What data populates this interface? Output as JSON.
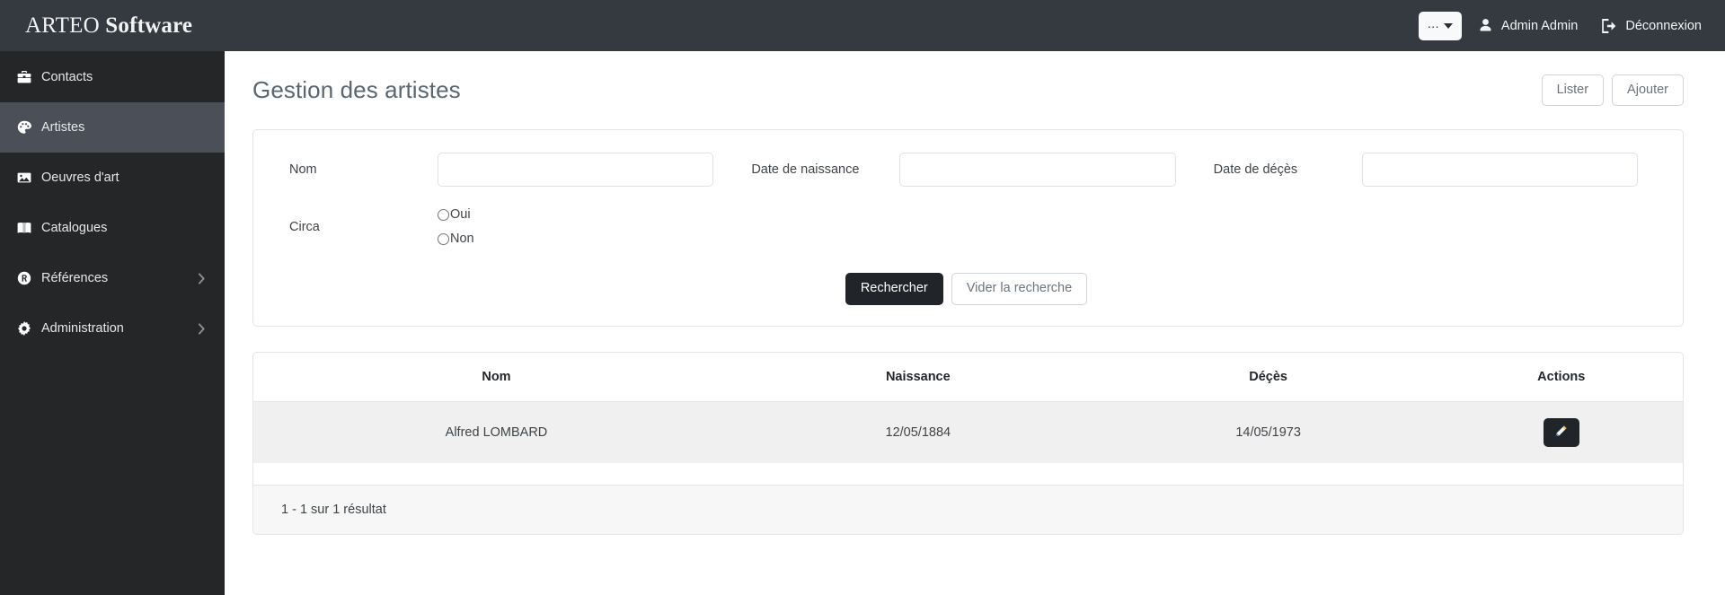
{
  "topbar": {
    "brand_prefix": "ARTEO ",
    "brand_suffix": "Software",
    "lang_button_label": "...",
    "lang_icon": "chevron-down-icon",
    "user_icon": "user-icon",
    "user_name": "Admin Admin",
    "logout_icon": "logout-icon",
    "logout_label": "Déconnexion"
  },
  "sidebar": {
    "items": [
      {
        "label": "Contacts",
        "icon": "briefcase-icon",
        "active": false,
        "expandable": false
      },
      {
        "label": "Artistes",
        "icon": "palette-icon",
        "active": true,
        "expandable": false
      },
      {
        "label": "Oeuvres d'art",
        "icon": "image-icon",
        "active": false,
        "expandable": false
      },
      {
        "label": "Catalogues",
        "icon": "book-icon",
        "active": false,
        "expandable": false
      },
      {
        "label": "Références",
        "icon": "registered-icon",
        "active": false,
        "expandable": true
      },
      {
        "label": "Administration",
        "icon": "gear-icon",
        "active": false,
        "expandable": true
      }
    ]
  },
  "page": {
    "title": "Gestion des artistes",
    "list_button": "Lister",
    "add_button": "Ajouter"
  },
  "search": {
    "nom_label": "Nom",
    "nom_value": "",
    "nom_placeholder": "",
    "naissance_label": "Date de naissance",
    "naissance_value": "",
    "naissance_placeholder": "",
    "deces_label": "Date de déçès",
    "deces_value": "",
    "deces_placeholder": "",
    "circa_label": "Circa",
    "circa_options": [
      "Oui",
      "Non"
    ],
    "circa_selected": null,
    "submit_label": "Rechercher",
    "reset_label": "Vider la recherche"
  },
  "table": {
    "columns": [
      "Nom",
      "Naissance",
      "Déçès",
      "Actions"
    ],
    "rows": [
      {
        "nom": "Alfred LOMBARD",
        "naissance": "12/05/1884",
        "deces": "14/05/1973",
        "action_icon": "pencil-icon"
      }
    ],
    "footer_text": "1 - 1 sur 1 résultat"
  },
  "colors": {
    "topbar_bg": "#343a40",
    "sidebar_bg": "#252628",
    "sidebar_active_bg": "#4b5058",
    "dark_button_bg": "#212529",
    "row_bg": "#f0f0f0",
    "footer_bg": "#f7f7f7",
    "title_color": "#5b6670"
  }
}
